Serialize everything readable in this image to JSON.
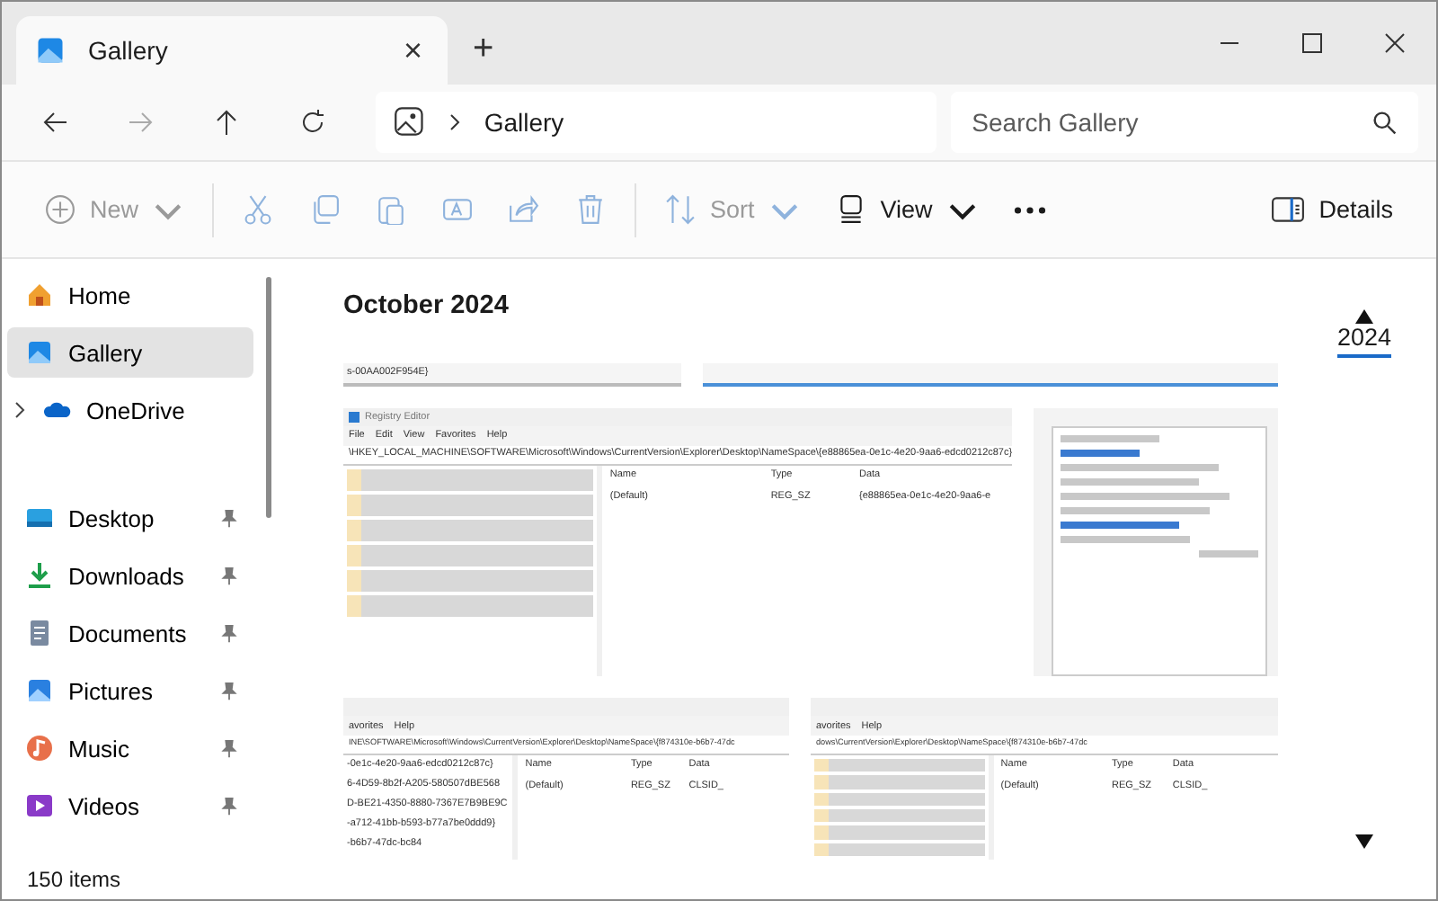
{
  "window": {
    "tab_title": "Gallery",
    "close_tab": "×",
    "new_tab": "+"
  },
  "address": {
    "breadcrumb": "Gallery",
    "search": {
      "placeholder": "Search Gallery"
    }
  },
  "toolbar": {
    "items": [
      {
        "kind": "new",
        "label": "New",
        "disabled": true,
        "caret": true
      },
      {
        "kind": "cut",
        "disabled": true
      },
      {
        "kind": "copy",
        "disabled": true
      },
      {
        "kind": "paste",
        "disabled": true
      },
      {
        "kind": "rename",
        "disabled": true
      },
      {
        "kind": "share",
        "disabled": true
      },
      {
        "kind": "delete",
        "disabled": true
      },
      {
        "kind": "sort",
        "label": "Sort",
        "disabled": true,
        "caret": true
      },
      {
        "kind": "view",
        "label": "View",
        "disabled": false,
        "caret": true
      },
      {
        "kind": "more",
        "disabled": false
      }
    ],
    "details": "Details"
  },
  "sidebar": {
    "items": [
      {
        "kind": "home",
        "label": "Home",
        "selected": false
      },
      {
        "kind": "gallery",
        "label": "Gallery",
        "selected": true
      },
      {
        "kind": "onedrive",
        "label": "OneDrive",
        "selected": false,
        "expandable": true
      }
    ],
    "quick_access": [
      {
        "kind": "desktop",
        "label": "Desktop",
        "selected": false,
        "pinned": true
      },
      {
        "kind": "downloads",
        "label": "Downloads",
        "selected": false,
        "pinned": true
      },
      {
        "kind": "documents",
        "label": "Documents",
        "selected": false,
        "pinned": true
      },
      {
        "kind": "pictures",
        "label": "Pictures",
        "selected": false,
        "pinned": true
      },
      {
        "kind": "music",
        "label": "Music",
        "selected": false,
        "pinned": true
      },
      {
        "kind": "videos",
        "label": "Videos",
        "selected": false,
        "pinned": true
      }
    ]
  },
  "gallery": {
    "heading": "October 2024",
    "rows": [
      [
        {
          "kind": "strip",
          "texts": [
            "s-00AA002F954E}"
          ]
        },
        {
          "kind": "strip"
        }
      ],
      [
        {
          "kind": "registry",
          "title": "Registry Editor",
          "menu": [
            "File",
            "Edit",
            "View",
            "Favorites",
            "Help"
          ],
          "path": "\\HKEY_LOCAL_MACHINE\\SOFTWARE\\Microsoft\\Windows\\CurrentVersion\\Explorer\\Desktop\\NameSpace\\{e88865ea-0e1c-4e20-9aa6-edcd0212c87c}",
          "columns": [
            "Name",
            "Type",
            "Data"
          ],
          "cells": [
            "(Default)",
            "REG_SZ",
            "{e88865ea-0e1c-4e20-9aa6-e"
          ]
        },
        {
          "kind": "dialog"
        }
      ],
      [
        {
          "kind": "registry",
          "menu": [
            "avorites",
            "Help"
          ],
          "path": "INE\\SOFTWARE\\Microsoft\\Windows\\CurrentVersion\\Explorer\\Desktop\\NameSpace\\{f874310e-b6b7-47dc",
          "tree": [
            "-0e1c-4e20-9aa6-edcd0212c87c}",
            "6-4D59-8b2f-A205-580507dBE568",
            "D-BE21-4350-8880-7367E7B9BE9C",
            "-a712-41bb-b593-b77a7be0ddd9}",
            "-b6b7-47dc-bc84"
          ],
          "columns": [
            "Name",
            "Type",
            "Data"
          ],
          "cells": [
            "(Default)",
            "REG_SZ",
            "CLSID_"
          ]
        },
        {
          "kind": "registry",
          "menu": [
            "avorites",
            "Help"
          ],
          "path": "dows\\CurrentVersion\\Explorer\\Desktop\\NameSpace\\{f874310e-b6b7-47dc",
          "columns": [
            "Name",
            "Type",
            "Data"
          ],
          "cells": [
            "(Default)",
            "REG_SZ",
            "CLSID_"
          ]
        }
      ]
    ]
  },
  "timeline": {
    "year": "2024"
  },
  "status_bar": {
    "count": "150 items"
  }
}
